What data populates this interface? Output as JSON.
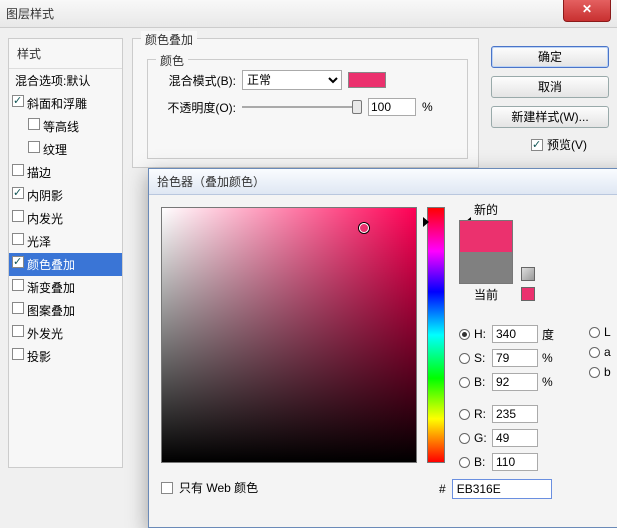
{
  "window": {
    "title": "图层样式"
  },
  "styles": {
    "header": "样式",
    "items": [
      {
        "label": "混合选项:默认",
        "kind": "blend"
      },
      {
        "label": "斜面和浮雕",
        "checked": true
      },
      {
        "label": "等高线",
        "checked": false,
        "sub": true
      },
      {
        "label": "纹理",
        "checked": false,
        "sub": true
      },
      {
        "label": "描边",
        "checked": false
      },
      {
        "label": "内阴影",
        "checked": true
      },
      {
        "label": "内发光",
        "checked": false
      },
      {
        "label": "光泽",
        "checked": false
      },
      {
        "label": "颜色叠加",
        "checked": true,
        "selected": true
      },
      {
        "label": "渐变叠加",
        "checked": false
      },
      {
        "label": "图案叠加",
        "checked": false
      },
      {
        "label": "外发光",
        "checked": false
      },
      {
        "label": "投影",
        "checked": false
      }
    ]
  },
  "color_overlay": {
    "group_title": "颜色叠加",
    "inner_title": "颜色",
    "blend_mode_label": "混合模式(B):",
    "blend_mode_value": "正常",
    "swatch_color": "#EB316E",
    "opacity_label": "不透明度(O):",
    "opacity_value": "100",
    "opacity_unit": "%"
  },
  "buttons": {
    "ok": "确定",
    "cancel": "取消",
    "new_style": "新建样式(W)...",
    "preview": "预览(V)"
  },
  "picker": {
    "title": "拾色器（叠加颜色）",
    "new_label": "新的",
    "current_label": "当前",
    "new_color": "#EB316E",
    "current_color": "#808080",
    "warn_color": "#EB316E",
    "hsb": {
      "h_label": "H:",
      "h_value": "340",
      "h_unit": "度",
      "s_label": "S:",
      "s_value": "79",
      "s_unit": "%",
      "b_label": "B:",
      "b_value": "92",
      "b_unit": "%"
    },
    "rgb": {
      "r_label": "R:",
      "r_value": "235",
      "g_label": "G:",
      "g_value": "49",
      "b_label": "B:",
      "b_value": "110"
    },
    "lab": {
      "l_label": "L",
      "a_label": "a",
      "b_label": "b"
    },
    "web_only": "只有 Web 颜色",
    "hex_prefix": "#",
    "hex_value": "EB316E"
  }
}
